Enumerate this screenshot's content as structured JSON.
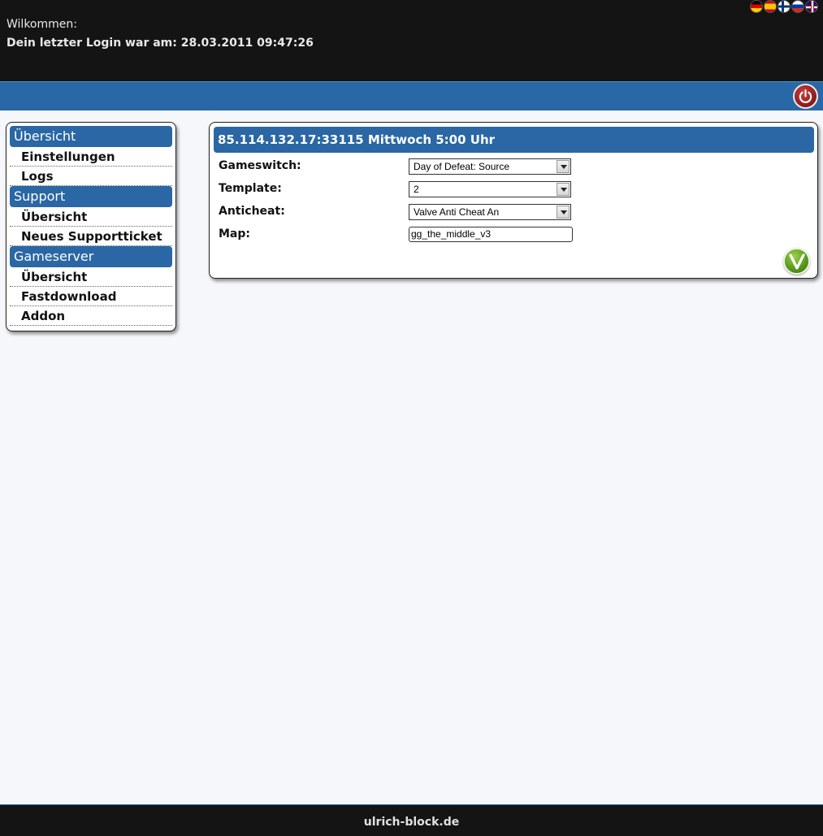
{
  "header": {
    "welcome": "Wilkommen:",
    "last_login": "Dein letzter Login war am: 28.03.2011 09:47:26",
    "flags": [
      "flag-de-icon",
      "flag-es-icon",
      "flag-fi-icon",
      "flag-ru-icon",
      "flag-gb-icon"
    ]
  },
  "topbar": {
    "logout_icon": "power-icon",
    "accent": "#2868a7"
  },
  "sidebar": {
    "sections": [
      {
        "title": "Übersicht",
        "items": [
          "Einstellungen",
          "Logs"
        ]
      },
      {
        "title": "Support",
        "items": [
          "Übersicht",
          "Neues Supportticket"
        ]
      },
      {
        "title": "Gameserver",
        "items": [
          "Übersicht",
          "Fastdownload",
          "Addon"
        ]
      }
    ]
  },
  "main": {
    "title": "85.114.132.17:33115 Mittwoch 5:00 Uhr",
    "form": {
      "gameswitch_label": "Gameswitch:",
      "gameswitch_value": "Day of Defeat: Source",
      "template_label": "Template:",
      "template_value": "2",
      "anticheat_label": "Anticheat:",
      "anticheat_value": "Valve Anti Cheat An",
      "map_label": "Map:",
      "map_value": "gg_the_middle_v3"
    },
    "confirm_icon": "checkmark-icon"
  },
  "footer": {
    "text": "ulrich-block.de"
  }
}
